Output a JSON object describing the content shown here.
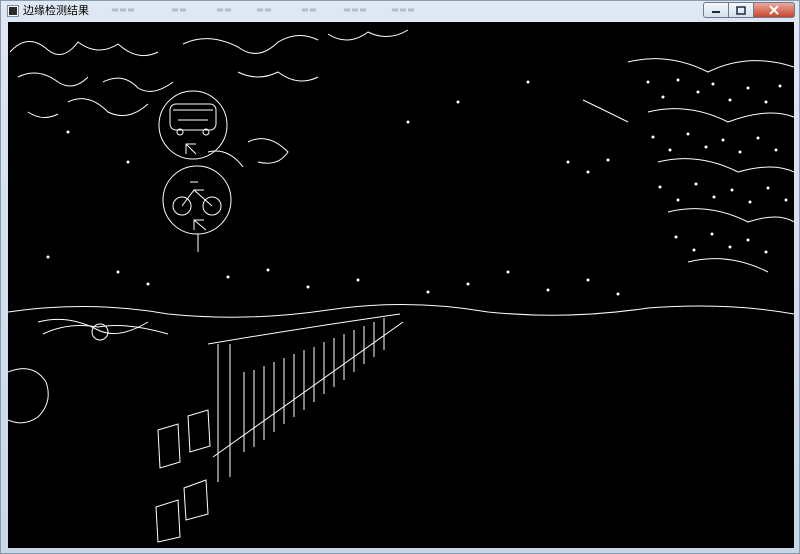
{
  "window": {
    "title": "边缘检测结果",
    "controls": {
      "minimize": "minimize",
      "maximize": "maximize",
      "close": "close"
    },
    "icons": {
      "app": "app-icon",
      "minimize": "minimize-icon",
      "maximize": "maximize-icon",
      "close": "close-icon"
    }
  },
  "image": {
    "type": "edge-detection-output",
    "background": "#000000",
    "edge_color": "#ffffff"
  }
}
